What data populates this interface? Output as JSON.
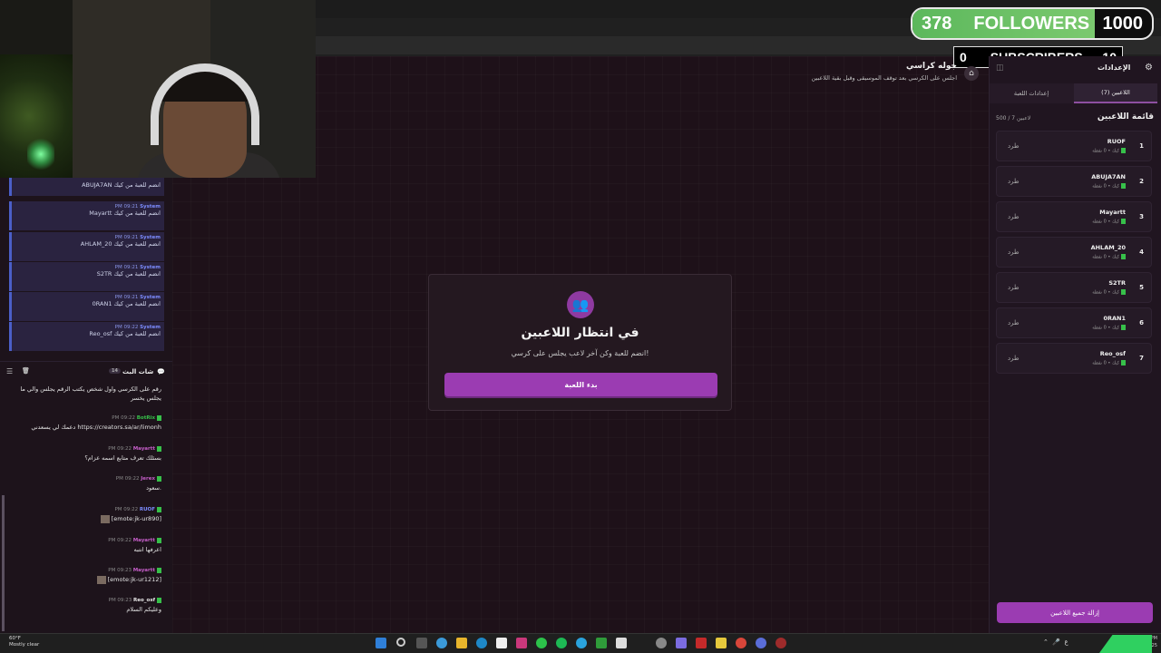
{
  "overlay": {
    "followers_count": "378",
    "followers_label": "FOLLOWERS",
    "followers_goal": "1000",
    "followers_progress": 0.378,
    "subscribers_count": "0",
    "subscribers_label": "SUBSCRIBERS",
    "subscribers_goal": "10"
  },
  "game": {
    "title": "جوله كراسي",
    "subtitle": "اجلس على الكرسي بعد توقف الموسيقى وقبل بقية اللاعبين"
  },
  "card": {
    "title": "في انتظار اللاعبين",
    "subtitle": "انضم للعبة وكن آخر لاعب يجلس على كرسي!",
    "button": "بدء اللعبة"
  },
  "settings": {
    "title": "الإعدادات",
    "tabs": [
      "اللاعبين (7)",
      "إعدادات اللعبة"
    ],
    "list_title": "قائمة اللاعبين",
    "count": "500 / 7 لاعبين",
    "remove_all": "إزالة جميع اللاعبين",
    "players": [
      {
        "num": "1",
        "name": "RUOF",
        "pts": "كيك • 0 نقطة",
        "kick": "طرد"
      },
      {
        "num": "2",
        "name": "ABUJA7AN",
        "pts": "كيك • 0 نقطة",
        "kick": "طرد"
      },
      {
        "num": "3",
        "name": "Mayartt",
        "pts": "كيك • 0 نقطة",
        "kick": "طرد"
      },
      {
        "num": "4",
        "name": "AHLAM_20",
        "pts": "كيك • 0 نقطة",
        "kick": "طرد"
      },
      {
        "num": "5",
        "name": "S2TR",
        "pts": "كيك • 0 نقطة",
        "kick": "طرد"
      },
      {
        "num": "6",
        "name": "0RAN1",
        "pts": "كيك • 0 نقطة",
        "kick": "طرد"
      },
      {
        "num": "7",
        "name": "Reo_osf",
        "pts": "كيك • 0 نقطة",
        "kick": "طرد"
      }
    ]
  },
  "system_messages": [
    {
      "meta_time": "PM 09:21",
      "meta_user": "System",
      "text": "ABUJA7AN انضم للعبة من كيك"
    },
    {
      "meta_time": "PM 09:21",
      "meta_user": "System",
      "text": "Mayartt انضم للعبة من كيك"
    },
    {
      "meta_time": "PM 09:21",
      "meta_user": "System",
      "text": "AHLAM_20 انضم للعبة من كيك"
    },
    {
      "meta_time": "PM 09:21",
      "meta_user": "System",
      "text": "S2TR انضم للعبة من كيك"
    },
    {
      "meta_time": "PM 09:21",
      "meta_user": "System",
      "text": "0RAN1 انضم للعبة من كيك"
    },
    {
      "meta_time": "PM 09:22",
      "meta_user": "System",
      "text": "Reo_osf انضم للعبة من كيك"
    }
  ],
  "chat": {
    "title": "شات البث",
    "count": "14",
    "intro": "رقم على الكرسي واول شخص يكتب الرقم يجلس والي ما يجلس يخسر",
    "messages": [
      {
        "time": "PM 09:22",
        "user": "BotRix",
        "user_color": "#37c04a",
        "text": "دعمك لي يسعدني https://creators.sa/ar/limonh"
      },
      {
        "time": "PM 09:22",
        "user": "Mayartt",
        "user_color": "#c65ec9",
        "text": "بسئلك تعرف متابع اسمه عزام؟"
      },
      {
        "time": "PM 09:22",
        "user": "Jerex",
        "user_color": "#c65ec9",
        "text": "سعود."
      },
      {
        "time": "PM 09:22",
        "user": "RUOF",
        "user_color": "#7c8cff",
        "text": "[emote:jk-ur890]",
        "emote": true
      },
      {
        "time": "PM 09:22",
        "user": "Mayartt",
        "user_color": "#c65ec9",
        "text": "اعرفها انتبه"
      },
      {
        "time": "PM 09:23",
        "user": "Mayartt",
        "user_color": "#c65ec9",
        "text": "[emote:jk-ur1212]",
        "emote": true
      },
      {
        "time": "PM 09:23",
        "user": "Reo_osf",
        "user_color": "#e8e8e8",
        "text": "وعليكم السلام"
      }
    ]
  },
  "taskbar": {
    "temp": "60°F",
    "weather": "Mostly clear",
    "time": "9:23 PM",
    "date": "12/11/2025"
  }
}
